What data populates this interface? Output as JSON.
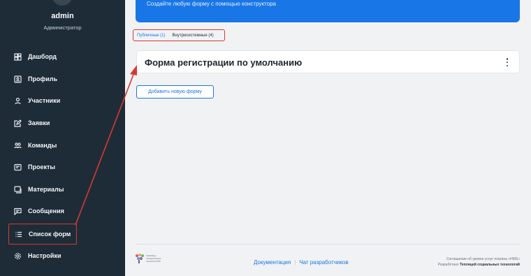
{
  "user": {
    "name": "admin",
    "role": "Администратор"
  },
  "nav": [
    {
      "label": "Дашборд",
      "icon": "dashboard-icon"
    },
    {
      "label": "Профиль",
      "icon": "profile-icon"
    },
    {
      "label": "Участники",
      "icon": "user-icon"
    },
    {
      "label": "Заявки",
      "icon": "edit-icon"
    },
    {
      "label": "Команды",
      "icon": "team-icon"
    },
    {
      "label": "Проекты",
      "icon": "projects-icon"
    },
    {
      "label": "Материалы",
      "icon": "materials-icon"
    },
    {
      "label": "Сообщения",
      "icon": "message-icon"
    },
    {
      "label": "Список форм",
      "icon": "list-icon"
    },
    {
      "label": "Настройки",
      "icon": "gear-icon"
    }
  ],
  "banner": {
    "text": "Создайте любую форму с помощью конструктора"
  },
  "tabs": {
    "public": "Публичные (1)",
    "internal": "Внутрисистемные (4)"
  },
  "forms": [
    {
      "title": "Форма регистрации по умолчанию"
    }
  ],
  "add_button": "Добавить новую форму",
  "footer": {
    "logo_text": "ТЕПЛИЦА СОЦИАЛЬНЫХ ТЕХНОЛОГИЙ",
    "docs_link": "Документация",
    "separator": "|",
    "dev_chat_link": "Чат разработчиков",
    "sla_line": "Соглашение об уровне услуг плагина «HMS»",
    "made_by_prefix": "Разработано",
    "made_by_org": "Теплицей социальных технологий"
  },
  "colors": {
    "sidebar": "#1e2c38",
    "accent": "#1976e6",
    "highlight": "#d63a2f"
  }
}
